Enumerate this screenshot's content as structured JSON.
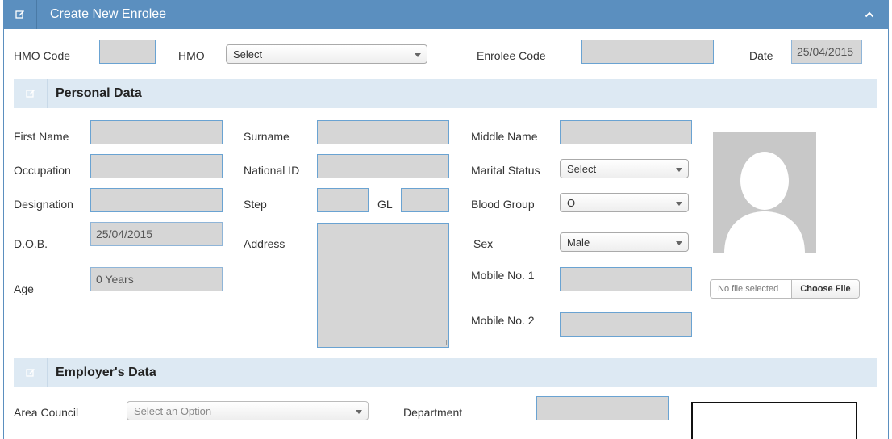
{
  "header": {
    "title": "Create New Enrolee"
  },
  "top_row": {
    "hmo_code_label": "HMO Code",
    "hmo_label": "HMO",
    "hmo_select": "Select",
    "enrolee_code_label": "Enrolee Code",
    "date_label": "Date",
    "date_value": "25/04/2015"
  },
  "personal": {
    "title": "Personal Data",
    "first_name_label": "First Name",
    "occupation_label": "Occupation",
    "designation_label": "Designation",
    "dob_label": "D.O.B.",
    "dob_value": "25/04/2015",
    "age_label": "Age",
    "age_value": "0 Years",
    "surname_label": "Surname",
    "national_id_label": "National ID",
    "step_label": "Step",
    "gl_label": "GL",
    "address_label": "Address",
    "middle_name_label": "Middle Name",
    "marital_status_label": "Marital Status",
    "marital_status_value": "Select",
    "blood_group_label": "Blood Group",
    "blood_group_value": "O",
    "sex_label": "Sex",
    "sex_value": "Male",
    "mobile1_label": "Mobile No. 1",
    "mobile2_label": "Mobile No. 2",
    "file_status": "No file selected",
    "choose_file": "Choose File"
  },
  "employer": {
    "title": "Employer's Data",
    "area_council_label": "Area Council",
    "area_council_placeholder": "Select an Option",
    "department_label": "Department"
  },
  "colors": {
    "header_bg": "#5b8fbf",
    "section_bg": "#dde9f3",
    "field_bg": "#d6d6d6",
    "field_border": "#6aa3d2"
  },
  "icons": {
    "header_icon": "edit-icon",
    "collapse_icon": "chevron-up-icon",
    "section_icon": "edit-icon",
    "avatar": "person-silhouette"
  }
}
